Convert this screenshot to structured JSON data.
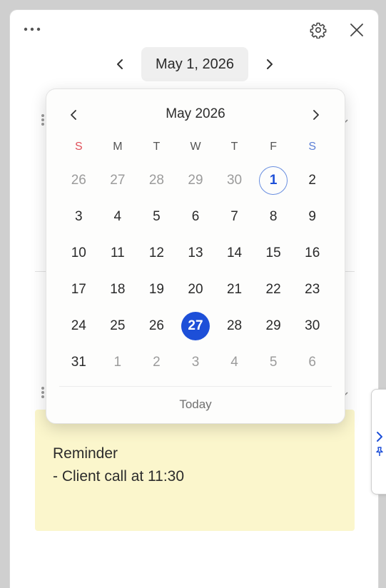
{
  "topbar": {
    "more_icon": "more-horizontal-icon",
    "settings_icon": "gear-icon",
    "close_icon": "close-icon"
  },
  "datebar": {
    "current_date": "May 1, 2026"
  },
  "calendar": {
    "month_label": "May 2026",
    "weekdays": [
      "S",
      "M",
      "T",
      "W",
      "T",
      "F",
      "S"
    ],
    "weekday_colors": {
      "sunday": "#e0505a",
      "saturday": "#5b7fd6",
      "default": "#555555"
    },
    "weeks": [
      [
        "26",
        "27",
        "28",
        "29",
        "30",
        "1",
        "2"
      ],
      [
        "3",
        "4",
        "5",
        "6",
        "7",
        "8",
        "9"
      ],
      [
        "10",
        "11",
        "12",
        "13",
        "14",
        "15",
        "16"
      ],
      [
        "17",
        "18",
        "19",
        "20",
        "21",
        "22",
        "23"
      ],
      [
        "24",
        "25",
        "26",
        "27",
        "28",
        "29",
        "30"
      ],
      [
        "31",
        "1",
        "2",
        "3",
        "4",
        "5",
        "6"
      ]
    ],
    "selected_day": "1",
    "today_day": "27",
    "today_label": "Today",
    "accent_color": "#1d4fd8"
  },
  "note": {
    "background": "#fbf6cc",
    "lines": [
      "Reminder",
      "- Client call at 11:30"
    ]
  },
  "side_tab": {
    "expand_icon": "chevron-right-icon",
    "pin_icon": "pin-icon"
  }
}
